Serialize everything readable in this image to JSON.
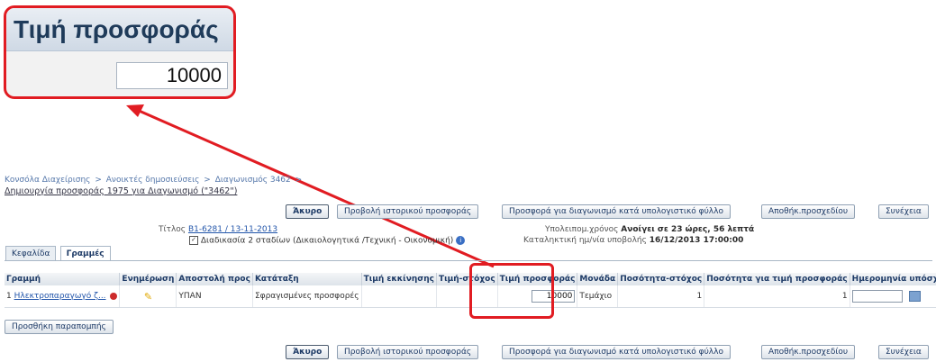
{
  "zoom": {
    "header": "Τιμή προσφοράς",
    "value": "10000"
  },
  "breadcrumb": [
    "Κονσόλα Διαχείρισης",
    ">",
    "Ανοικτές δημοσιεύσεις",
    ">",
    "Διαγωνισμός 3462",
    ">"
  ],
  "page_title": "Δημιουργία προσφοράς 1975 για Διαγωνισμό (\"3462\")",
  "buttons": {
    "cancel": "Άκυρο",
    "history": "Προβολή ιστορικού προσφοράς",
    "spreadsheet": "Προσφορά για διαγωνισμό κατά υπολογιστικό φύλλο",
    "save_draft": "Αποθήκ.προσχεδίου",
    "continue": "Συνέχεια",
    "add_reference": "Προσθήκη παραπομπής"
  },
  "info": {
    "title_label": "Τίτλος",
    "title_value": "Β1-6281 / 13-11-2013",
    "procedure": "Διαδικασία 2 σταδίων (Δικαιολογητικά /Τεχνική - Οικονομική)",
    "remaining_label": "Υπολειπομ.χρόνος",
    "remaining_value": "Ανοίγει σε 23 ώρες, 56 λεπτά",
    "deadline_label": "Καταληκτική ημ/νία υποβολής",
    "deadline_value": "16/12/2013 17:00:00"
  },
  "tabs": [
    "Κεφαλίδα",
    "Γραμμές"
  ],
  "table": {
    "columns": [
      "Γραμμή",
      "Ενημέρωση",
      "Αποστολή προς",
      "Κατάταξη",
      "Τιμή εκκίνησης",
      "Τιμή-στόχος",
      "Τιμή προσφοράς",
      "Μονάδα",
      "Ποσότητα-στόχος",
      "Ποσότητα για τιμή προσφοράς",
      "Ημερομηνία υπόσχεσης"
    ],
    "rows": [
      {
        "line": "1",
        "item": "Ηλεκτροπαραγωγό ζ...",
        "ship_to": "ΥΠΑΝ",
        "rank": "Σφραγισμένες προσφορές",
        "start_price": "",
        "target_price": "",
        "bid_price": "10000",
        "unit": "Τεμάχιο",
        "target_qty": "1",
        "bid_qty": "1"
      }
    ]
  },
  "colors": {
    "highlight": "#e11c22",
    "link": "#2255aa",
    "header_text": "#1d3a66"
  }
}
